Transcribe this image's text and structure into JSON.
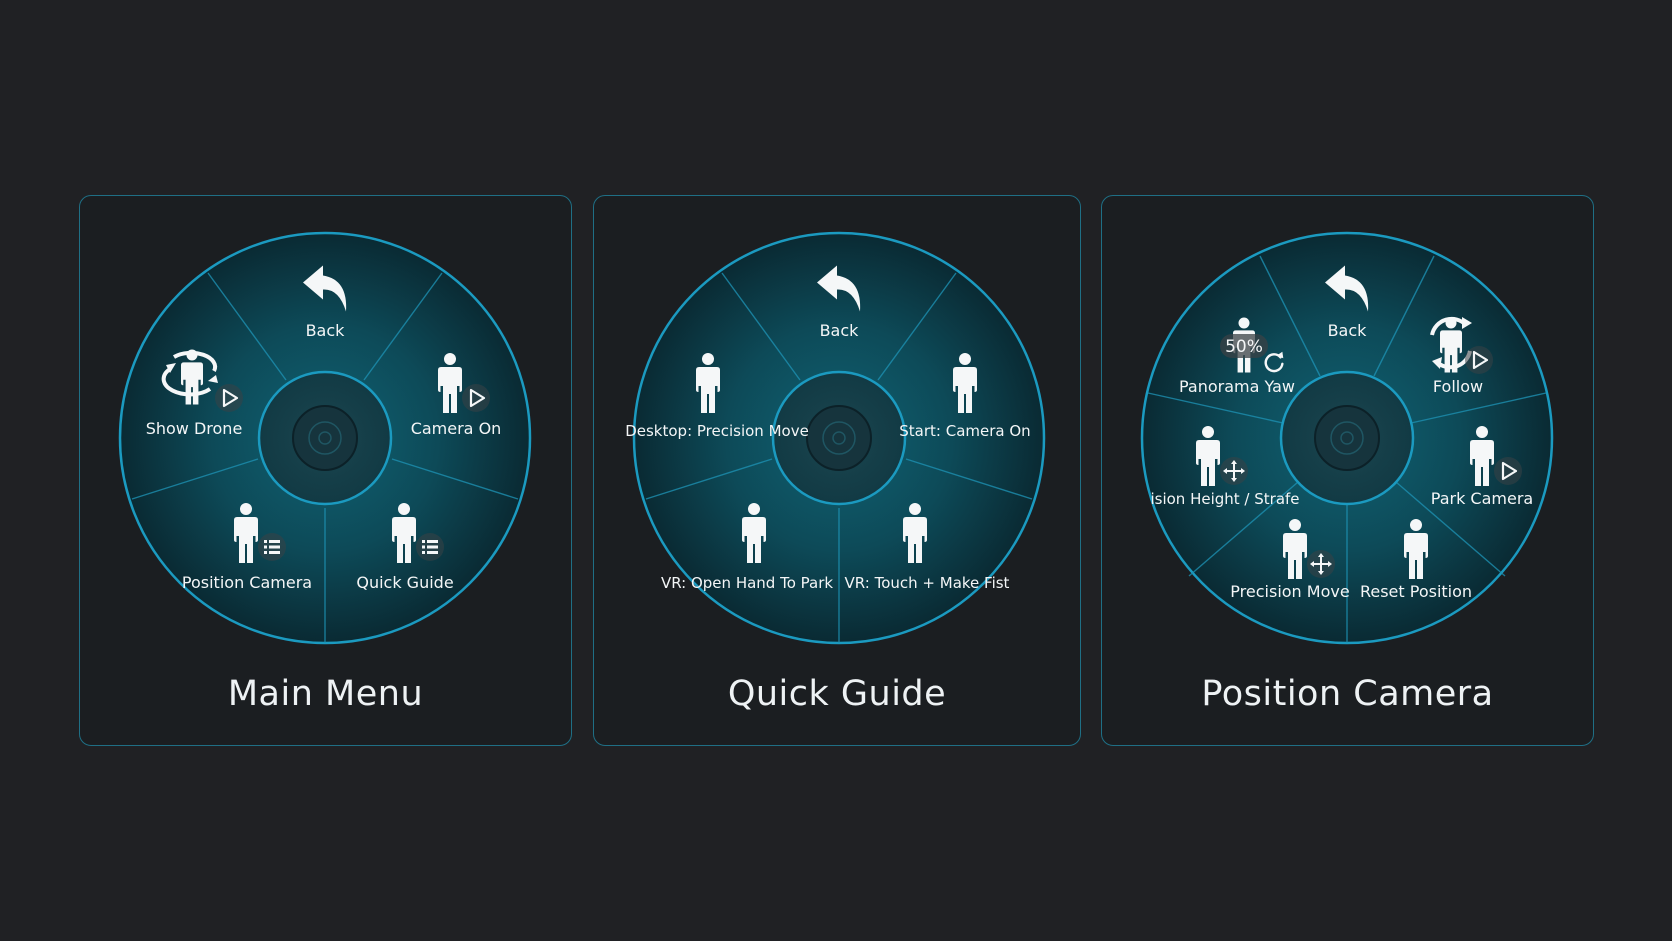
{
  "colors": {
    "page_background": "#202124",
    "panel_border": "#1f6f85",
    "ring_stroke": "#1b9ac0",
    "wheel_fill_center": "#0e5c6d",
    "wheel_fill_edge": "#0b2e38",
    "label_text": "#f4f6f7"
  },
  "panels": [
    {
      "title": "Main Menu",
      "items": {
        "back": "Back",
        "show_drone": "Show Drone",
        "camera_on": "Camera On",
        "position_camera": "Position Camera",
        "quick_guide": "Quick Guide"
      }
    },
    {
      "title": "Quick Guide",
      "items": {
        "back": "Back",
        "desktop_precision_move": "Desktop: Precision Move",
        "start_camera_on": "Start: Camera On",
        "vr_open_hand_to_park": "VR: Open Hand To Park",
        "vr_touch_make_fist": "VR: Touch + Make Fist"
      }
    },
    {
      "title": "Position Camera",
      "items": {
        "back": "Back",
        "panorama_yaw": "Panorama Yaw",
        "panorama_yaw_percent": "50%",
        "follow": "Follow",
        "precision_height_strafe": "ision Height / Strafe",
        "park_camera": "Park Camera",
        "precision_move": "Precision Move",
        "reset_position": "Reset Position"
      }
    }
  ],
  "icons": [
    "back-arrow-icon",
    "person-icon",
    "play-icon",
    "list-icon",
    "move-arrows-icon",
    "rotate-icon",
    "drone-orbit-icon",
    "center-target-icon"
  ]
}
